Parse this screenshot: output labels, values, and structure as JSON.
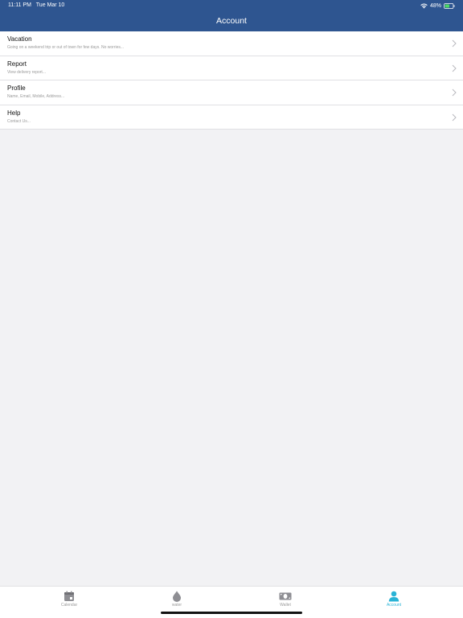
{
  "status_bar": {
    "time": "11:11 PM",
    "date": "Tue Mar 10",
    "battery": "48%"
  },
  "header": {
    "title": "Account",
    "background": "#2e5590"
  },
  "menu": {
    "items": [
      {
        "title": "Vacation",
        "subtitle": "Going on a weekend trip or out of town for few days. No worries..."
      },
      {
        "title": "Report",
        "subtitle": "View delivery report..."
      },
      {
        "title": "Profile",
        "subtitle": "Name, Email, Mobile, Address..."
      },
      {
        "title": "Help",
        "subtitle": "Contact Us..."
      }
    ]
  },
  "tab_bar": {
    "active_color": "#29b3d6",
    "inactive_color": "#9a9a9a",
    "tabs": [
      {
        "label": "Calendar",
        "icon": "calendar-icon"
      },
      {
        "label": "water",
        "icon": "water-drop-icon"
      },
      {
        "label": "Wallet",
        "icon": "wallet-icon"
      },
      {
        "label": "Account",
        "icon": "account-icon",
        "active": true
      }
    ]
  }
}
